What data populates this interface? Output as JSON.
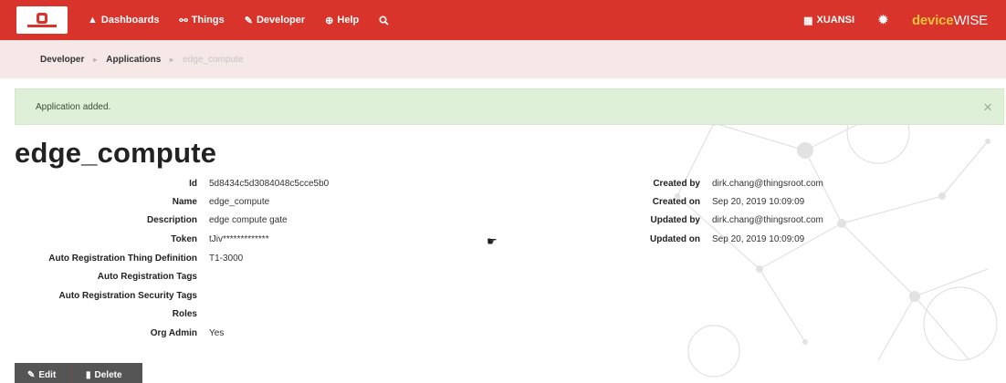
{
  "navbar": {
    "items": [
      {
        "icon": "dashboard-icon",
        "label": "Dashboards"
      },
      {
        "icon": "things-icon",
        "label": "Things"
      },
      {
        "icon": "wrench-icon",
        "label": "Developer"
      },
      {
        "icon": "help-icon",
        "label": "Help"
      }
    ],
    "org_label": "XUANSI",
    "brand_part1": "device",
    "brand_part2": "WISE"
  },
  "breadcrumb": {
    "items": [
      "Developer",
      "Applications"
    ],
    "current": "edge_compute"
  },
  "alert": {
    "message": "Application added.",
    "close_symbol": "×"
  },
  "page_title": "edge_compute",
  "details_left": [
    {
      "label": "Id",
      "value": "5d8434c5d3084048c5cce5b0"
    },
    {
      "label": "Name",
      "value": "edge_compute"
    },
    {
      "label": "Description",
      "value": "edge compute gate"
    },
    {
      "label": "Token",
      "value": "tJiv*************"
    },
    {
      "label": "Auto Registration Thing Definition",
      "value": "T1-3000"
    },
    {
      "label": "Auto Registration Tags",
      "value": ""
    },
    {
      "label": "Auto Registration Security Tags",
      "value": ""
    },
    {
      "label": "Roles",
      "value": ""
    },
    {
      "label": "Org Admin",
      "value": "Yes"
    }
  ],
  "details_right": [
    {
      "label": "Created by",
      "value": "dirk.chang@thingsroot.com"
    },
    {
      "label": "Created on",
      "value": "Sep 20, 2019 10:09:09"
    },
    {
      "label": "Updated by",
      "value": "dirk.chang@thingsroot.com"
    },
    {
      "label": "Updated on",
      "value": "Sep 20, 2019 10:09:09"
    }
  ],
  "actions": {
    "edit_label": "Edit",
    "delete_label": "Delete"
  },
  "colors": {
    "navbar": "#d8342b",
    "breadcrumb_bg": "#f7e8e8",
    "alert_bg": "#dff0d8",
    "button_bg": "#555555",
    "brand_accent": "#f0c23c"
  }
}
